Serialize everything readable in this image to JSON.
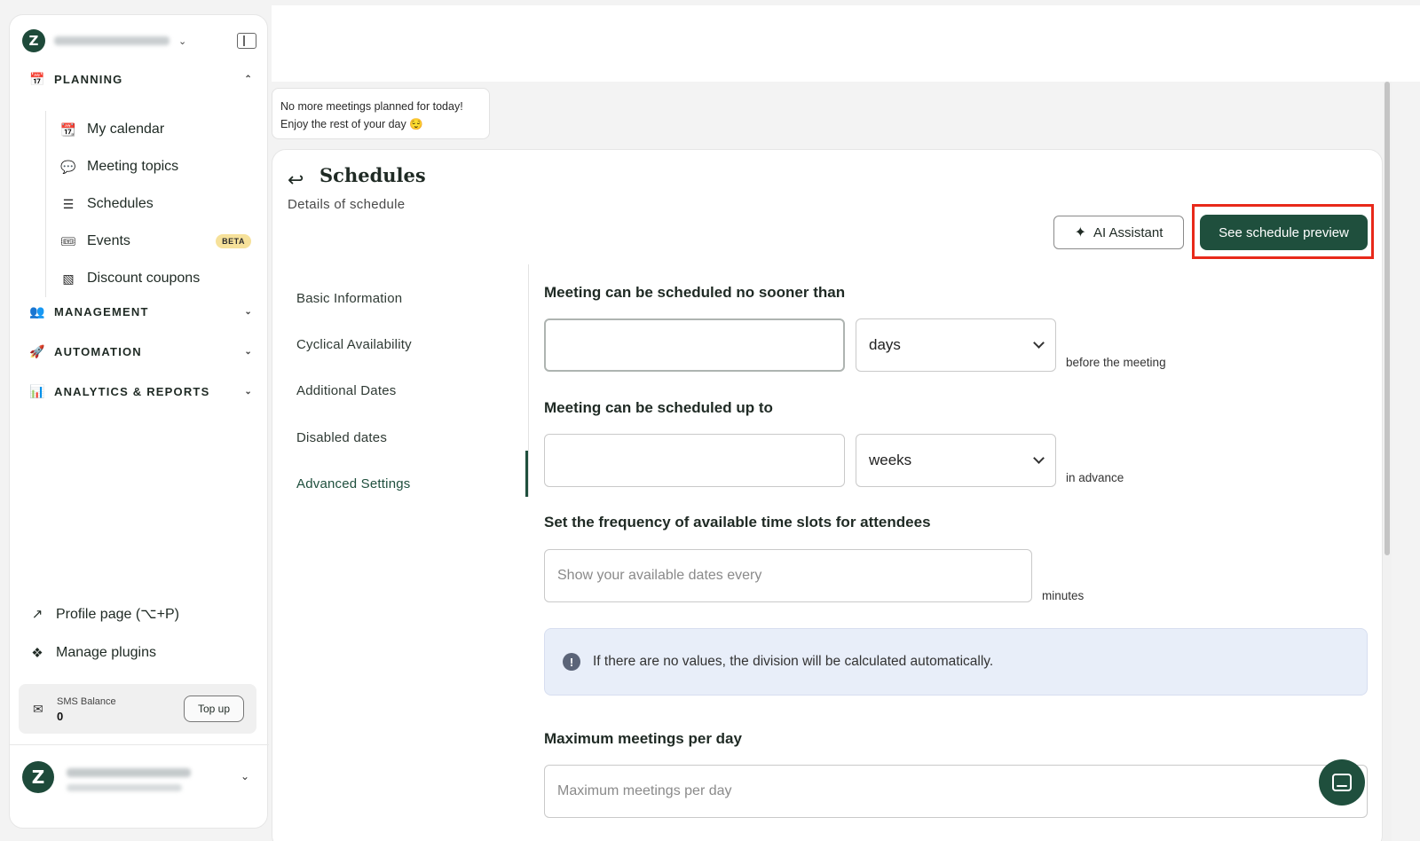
{
  "sidebar": {
    "planning": {
      "label": "PLANNING",
      "items": [
        {
          "label": "My calendar",
          "icon": "calendar-icon"
        },
        {
          "label": "Meeting topics",
          "icon": "chat-bubbles-icon"
        },
        {
          "label": "Schedules",
          "icon": "list-icon"
        },
        {
          "label": "Events",
          "icon": "ticket-icon",
          "badge": "BETA"
        },
        {
          "label": "Discount coupons",
          "icon": "coupon-icon"
        }
      ]
    },
    "management": {
      "label": "MANAGEMENT"
    },
    "automation": {
      "label": "AUTOMATION"
    },
    "analytics": {
      "label": "ANALYTICS & REPORTS"
    },
    "profile_link": "Profile page (⌥+P)",
    "plugins_link": "Manage plugins",
    "sms": {
      "label": "SMS Balance",
      "value": "0",
      "topup": "Top up"
    }
  },
  "toast": {
    "line1": "No more meetings planned for today!",
    "line2": "Enjoy the rest of your day 😌"
  },
  "header": {
    "title": "Schedules",
    "subtitle": "Details of schedule",
    "ai_button": "AI Assistant",
    "preview_button": "See schedule preview"
  },
  "subnav": [
    "Basic Information",
    "Cyclical Availability",
    "Additional Dates",
    "Disabled dates",
    "Advanced Settings"
  ],
  "form": {
    "no_sooner": {
      "label": "Meeting can be scheduled no sooner than",
      "value": "",
      "unit": "days",
      "suffix": "before the meeting"
    },
    "up_to": {
      "label": "Meeting can be scheduled up to",
      "value": "",
      "unit": "weeks",
      "suffix": "in advance"
    },
    "frequency": {
      "label": "Set the frequency of available time slots for attendees",
      "placeholder": "Show your available dates every",
      "suffix": "minutes"
    },
    "info": "If there are no values, the division will be calculated automatically.",
    "max_meetings": {
      "label": "Maximum meetings per day",
      "placeholder": "Maximum meetings per day"
    }
  },
  "colors": {
    "brand": "#1f4f3d",
    "highlight": "#e8291a",
    "info_bg": "#e8eef9",
    "beta_badge": "#f6e19a"
  }
}
